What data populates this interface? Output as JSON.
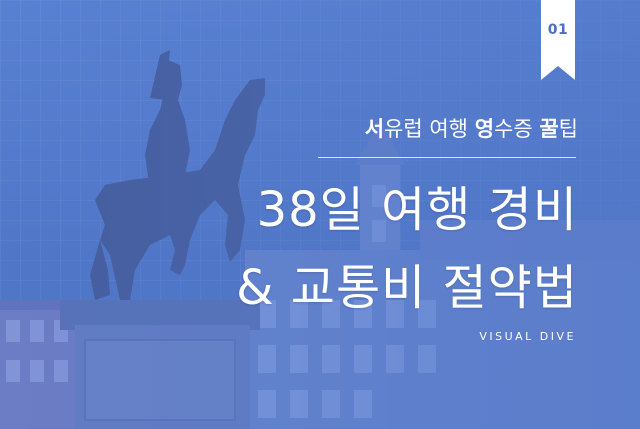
{
  "badge": {
    "number": "01"
  },
  "subtitle": {
    "part1_bold": "서",
    "part2": "유럽 여행 ",
    "part3_bold": "영",
    "part4": "수증 ",
    "part5_bold": "꿀",
    "part6": "팁"
  },
  "title": {
    "line1": "38일 여행 경비",
    "line2": "& 교통비 절약법"
  },
  "brand": "VISUAL DIVE",
  "colors": {
    "overlay": "#5277c8",
    "text": "#ffffff",
    "badge_text": "#4a70c2"
  },
  "icons": {
    "badge": "bookmark-ribbon"
  }
}
